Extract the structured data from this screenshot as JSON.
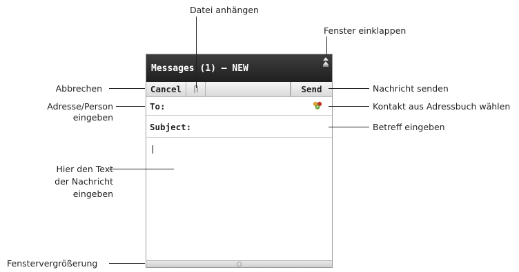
{
  "callouts": {
    "attach": "Datei anhängen",
    "collapse": "Fenster einklappen",
    "cancel": "Abbrechen",
    "send": "Nachricht senden",
    "address_line1": "Adresse/Person",
    "address_line2": "eingeben",
    "contact": "Kontakt aus Adressbuch wählen",
    "subject": "Betreff eingeben",
    "body_line1": "Hier den Text",
    "body_line2": "der Nachricht",
    "body_line3": "eingeben",
    "resize": "Fenstervergrößerung"
  },
  "window": {
    "title": "Messages (1) – NEW",
    "toolbar": {
      "cancel_label": "Cancel",
      "send_label": "Send"
    },
    "to_label": "To:",
    "subject_label": "Subject:"
  }
}
